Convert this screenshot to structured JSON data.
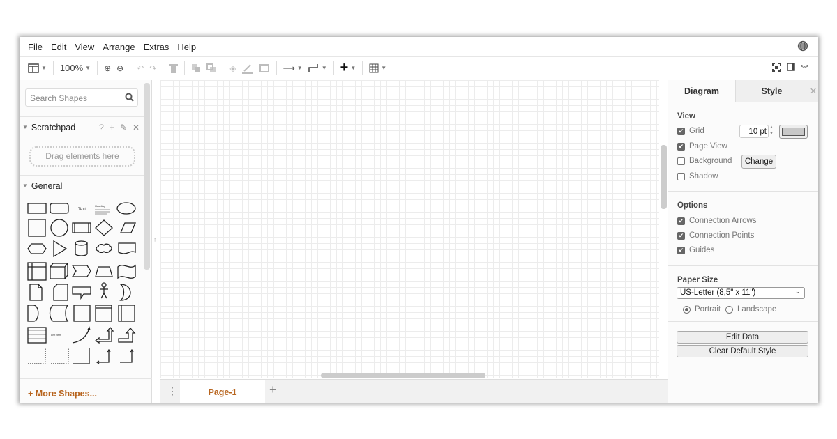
{
  "menubar": {
    "items": [
      "File",
      "Edit",
      "View",
      "Arrange",
      "Extras",
      "Help"
    ]
  },
  "toolbar": {
    "zoom": "100%"
  },
  "sidebar": {
    "search_placeholder": "Search Shapes",
    "scratchpad": {
      "title": "Scratchpad",
      "help": "?",
      "add": "+",
      "drop_hint": "Drag elements here"
    },
    "general": {
      "title": "General",
      "shape_text": "Text",
      "shape_heading": "Heading",
      "shape_list_item": "List Item"
    },
    "more_shapes": "More Shapes..."
  },
  "pages": {
    "current": "Page-1",
    "add": "+"
  },
  "panel": {
    "tabs": [
      "Diagram",
      "Style"
    ],
    "close": "✕",
    "view": {
      "title": "View",
      "grid": {
        "label": "Grid",
        "checked": true,
        "size": "10 pt",
        "color": "#c8c8c8"
      },
      "page_view": {
        "label": "Page View",
        "checked": true
      },
      "background": {
        "label": "Background",
        "checked": false,
        "button": "Change"
      },
      "shadow": {
        "label": "Shadow",
        "checked": false
      }
    },
    "options": {
      "title": "Options",
      "connection_arrows": {
        "label": "Connection Arrows",
        "checked": true
      },
      "connection_points": {
        "label": "Connection Points",
        "checked": true
      },
      "guides": {
        "label": "Guides",
        "checked": true
      }
    },
    "paper": {
      "title": "Paper Size",
      "selected": "US-Letter (8,5\" x 11\")",
      "orientation": "Portrait",
      "portrait": "Portrait",
      "landscape": "Landscape"
    },
    "buttons": {
      "edit_data": "Edit Data",
      "clear_style": "Clear Default Style"
    }
  },
  "colors": {
    "accent": "#b8651f"
  }
}
